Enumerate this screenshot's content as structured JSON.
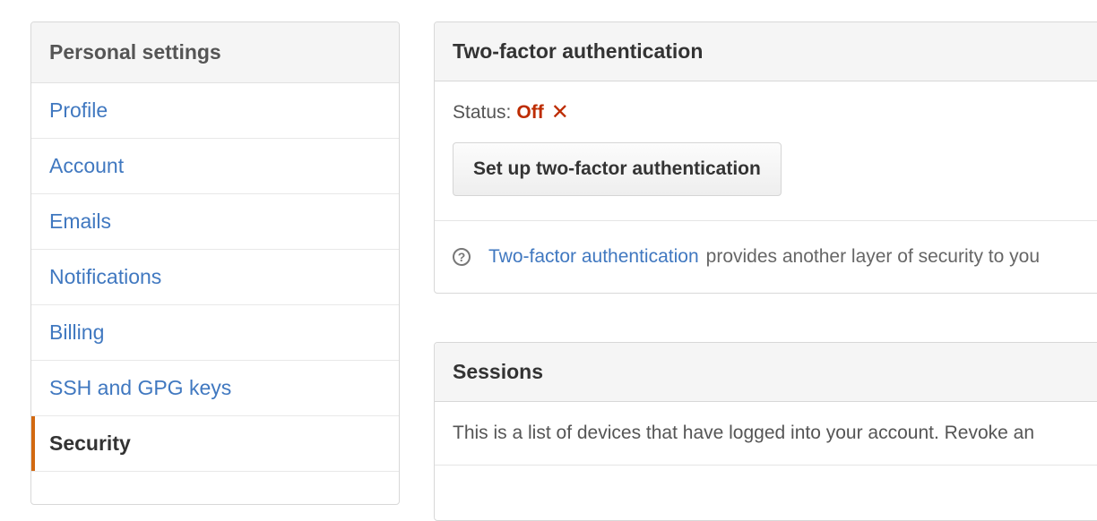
{
  "sidebar": {
    "title": "Personal settings",
    "items": [
      {
        "label": "Profile"
      },
      {
        "label": "Account"
      },
      {
        "label": "Emails"
      },
      {
        "label": "Notifications"
      },
      {
        "label": "Billing"
      },
      {
        "label": "SSH and GPG keys"
      },
      {
        "label": "Security",
        "selected": true
      }
    ]
  },
  "two_factor": {
    "title": "Two-factor authentication",
    "status_label": "Status:",
    "status_value": "Off",
    "status_icon": "x-icon",
    "setup_button": "Set up two-factor authentication",
    "help_icon": "question-circle-icon",
    "info_link": "Two-factor authentication",
    "info_text": "provides another layer of security to you"
  },
  "sessions": {
    "title": "Sessions",
    "description": "This is a list of devices that have logged into your account. Revoke an"
  },
  "colors": {
    "link": "#4078c0",
    "status_off": "#bd2c00",
    "selected_indicator": "#d26911"
  }
}
